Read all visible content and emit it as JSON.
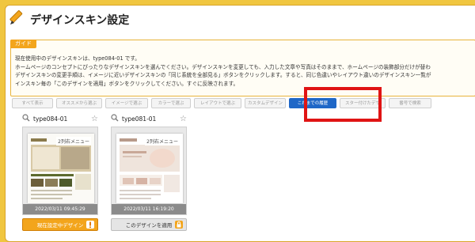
{
  "page": {
    "title": "デザインスキン設定"
  },
  "guide": {
    "tab_label": "ガイド",
    "lines": [
      "現在使用中のデザインスキンは、type084-01 です。",
      "ホームページのコンセプトにぴったりなデザインスキンを選んでください。デザインスキンを変更しても、入力した文章や写真はそのままで、ホームページの装飾部分だけが替わ",
      "デザインスキンの変更手順は、イメージに近いデザインスキンの「同じ系統を全部見る」ボタンをクリックします。すると、同じ色違いやレイアウト違いのデザインスキン一覧が",
      "インスキン毎の「このデザインを適用」ボタンをクリックしてください。すぐに反映されます。"
    ]
  },
  "tabs": [
    {
      "label": "すべて表示",
      "active": false
    },
    {
      "label": "オススメから選ぶ",
      "active": false
    },
    {
      "label": "イメージで選ぶ",
      "active": false
    },
    {
      "label": "カラーで選ぶ",
      "active": false
    },
    {
      "label": "レイアウトで選ぶ",
      "active": false
    },
    {
      "label": "カスタムデザイン",
      "active": false
    },
    {
      "label": "これまでの履歴",
      "active": true
    },
    {
      "label": "スター付けたデザ",
      "active": false
    },
    {
      "label": "番号で検索",
      "active": false
    }
  ],
  "designs": [
    {
      "name": "type084-01",
      "tag": "2列右メニュー",
      "date": "2022/03/11 09:45:29",
      "button_label": "現在設定中デザイン",
      "current": true
    },
    {
      "name": "type081-01",
      "tag": "2列右メニュー",
      "date": "2022/03/11 16:19:20",
      "button_label": "このデザインを適用",
      "current": false
    }
  ],
  "colors": {
    "page_bg": "#f0c640",
    "accent_orange": "#f3a51c",
    "active_tab": "#1f67c7",
    "highlight": "#e01414"
  },
  "icons": {
    "title": "pencil-icon",
    "search": "magnifier-icon",
    "favorite": "star-icon"
  }
}
